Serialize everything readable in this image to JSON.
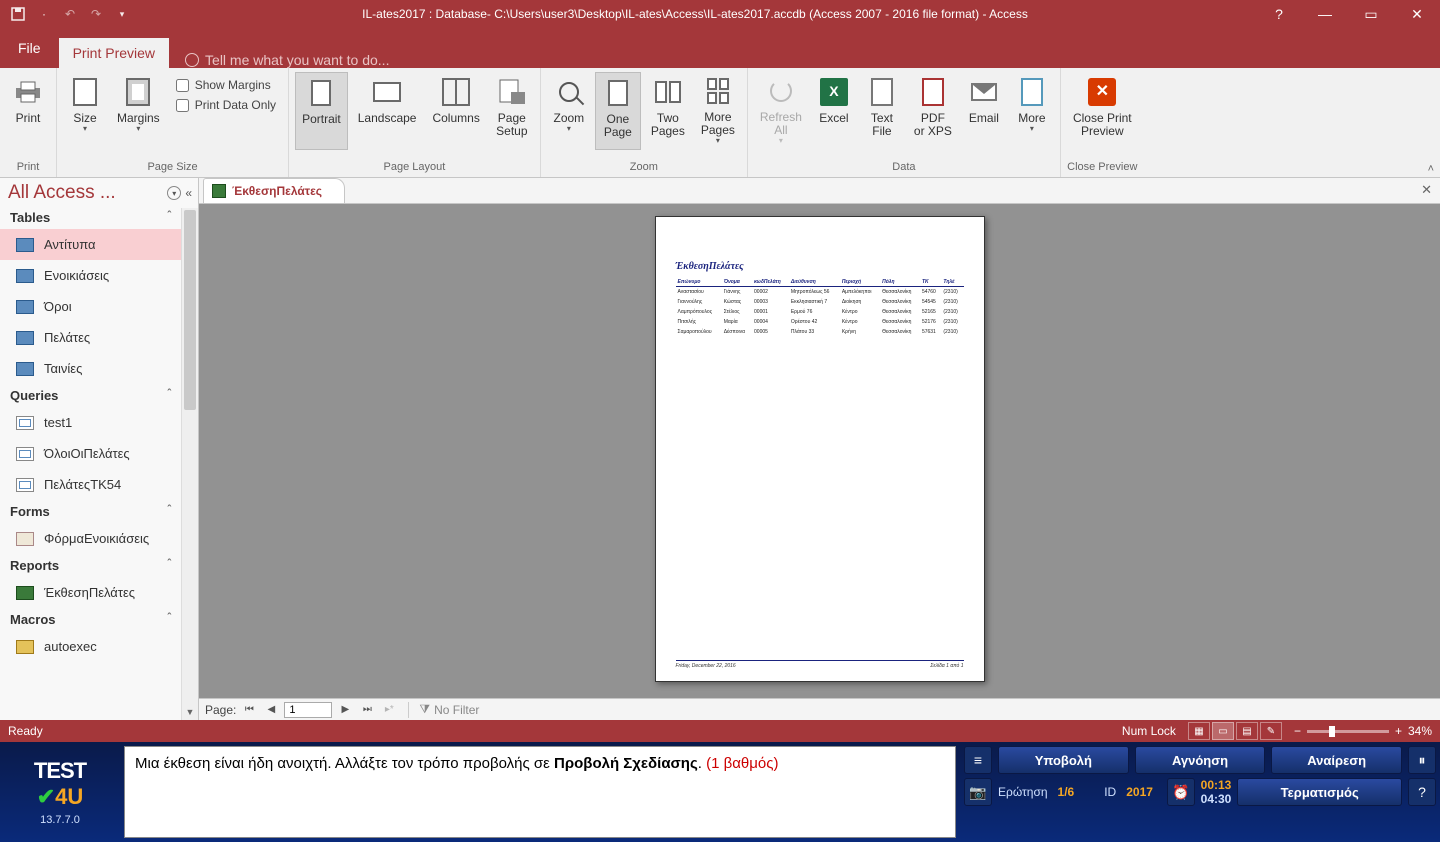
{
  "titlebar": {
    "title": "IL-ates2017 : Database- C:\\Users\\user3\\Desktop\\IL-ates\\Access\\IL-ates2017.accdb (Access 2007 - 2016 file format) - Access"
  },
  "tabs": {
    "file": "File",
    "printpreview": "Print Preview",
    "tellme": "Tell me what you want to do..."
  },
  "ribbon": {
    "print": {
      "label": "Print",
      "group": "Print"
    },
    "size": "Size",
    "margins": "Margins",
    "showMargins": "Show Margins",
    "printDataOnly": "Print Data Only",
    "pageSizeGroup": "Page Size",
    "portrait": "Portrait",
    "landscape": "Landscape",
    "columns": "Columns",
    "pageSetup": "Page\nSetup",
    "pageLayoutGroup": "Page Layout",
    "zoom": "Zoom",
    "onePage": "One\nPage",
    "twoPages": "Two\nPages",
    "morePages": "More\nPages",
    "zoomGroup": "Zoom",
    "refreshAll": "Refresh\nAll",
    "excel": "Excel",
    "textFile": "Text\nFile",
    "pdfXps": "PDF\nor XPS",
    "email": "Email",
    "more": "More",
    "dataGroup": "Data",
    "closePreview": "Close Print\nPreview",
    "closePreviewGroup": "Close Preview"
  },
  "nav": {
    "title": "All Access ...",
    "sections": {
      "tables": "Tables",
      "queries": "Queries",
      "forms": "Forms",
      "reports": "Reports",
      "macros": "Macros"
    },
    "tables": [
      "Αντίτυπα",
      "Ενοικιάσεις",
      "Όροι",
      "Πελάτες",
      "Ταινίες"
    ],
    "queries": [
      "test1",
      "ΌλοιΟιΠελάτες",
      "ΠελάτεςΤΚ54"
    ],
    "forms": [
      "ΦόρμαΕνοικιάσεις"
    ],
    "reports": [
      "ΈκθεσηΠελάτες"
    ],
    "macros": [
      "autoexec"
    ]
  },
  "docTab": {
    "label": "ΈκθεσηΠελάτες"
  },
  "report": {
    "title": "ΈκθεσηΠελάτες",
    "headers": [
      "Επώνυμο",
      "Όνομα",
      "κωδΠελάτη",
      "Διεύθυνση",
      "Περιοχή",
      "Πόλη",
      "ΤΚ",
      "Τηλέ"
    ],
    "rows": [
      [
        "Αναστασίου",
        "Γιάννης",
        "00002",
        "Μητροπόλεως 56",
        "Αμπελόκηποι",
        "Θεσσαλονίκη",
        "54760",
        "(2310)"
      ],
      [
        "Γιαννούλης",
        "Κώστας",
        "00003",
        "Εκκλησιαστική 7",
        "Διοίκηση",
        "Θεσσαλονίκη",
        "54545",
        "(2310)"
      ],
      [
        "Λαμπρόπουλος",
        "Στέλιος",
        "00001",
        "Ερμού 76",
        "Κέντρο",
        "Θεσσαλονίκη",
        "52165",
        "(2310)"
      ],
      [
        "Πιτσιλής",
        "Μαρία",
        "00004",
        "Ορέστου 42",
        "Κέντρο",
        "Θεσσαλονίκη",
        "52176",
        "(2310)"
      ],
      [
        "Σαμαροπούλου",
        "Δέσποινα",
        "00005",
        "Πλάτου 33",
        "Κρήνη",
        "Θεσσαλονίκη",
        "57631",
        "(2310)"
      ]
    ],
    "footerLeft": "Friday, December 22, 2016",
    "footerRight": "Σελίδα 1 από 1"
  },
  "pagenav": {
    "label": "Page:",
    "value": "1",
    "nofilter": "No Filter"
  },
  "status": {
    "ready": "Ready",
    "numlock": "Num Lock",
    "zoom": "34%"
  },
  "test4u": {
    "logo1": "TEST",
    "logo2": "4U",
    "version": "13.7.7.0",
    "msg_pre": "Μια έκθεση είναι ήδη ανοιχτή. Αλλάξτε τον τρόπο προβολής σε ",
    "msg_bold": "Προβολή Σχεδίασης",
    "msg_post": ". ",
    "msg_points": "(1 βαθμός)",
    "submit": "Υποβολή",
    "ignore": "Αγνόηση",
    "undo": "Αναίρεση",
    "terminate": "Τερματισμός",
    "question_k": "Ερώτηση",
    "question_v": "1/6",
    "id_k": "ID",
    "id_v": "2017",
    "time1": "00:13",
    "time2": "04:30"
  }
}
